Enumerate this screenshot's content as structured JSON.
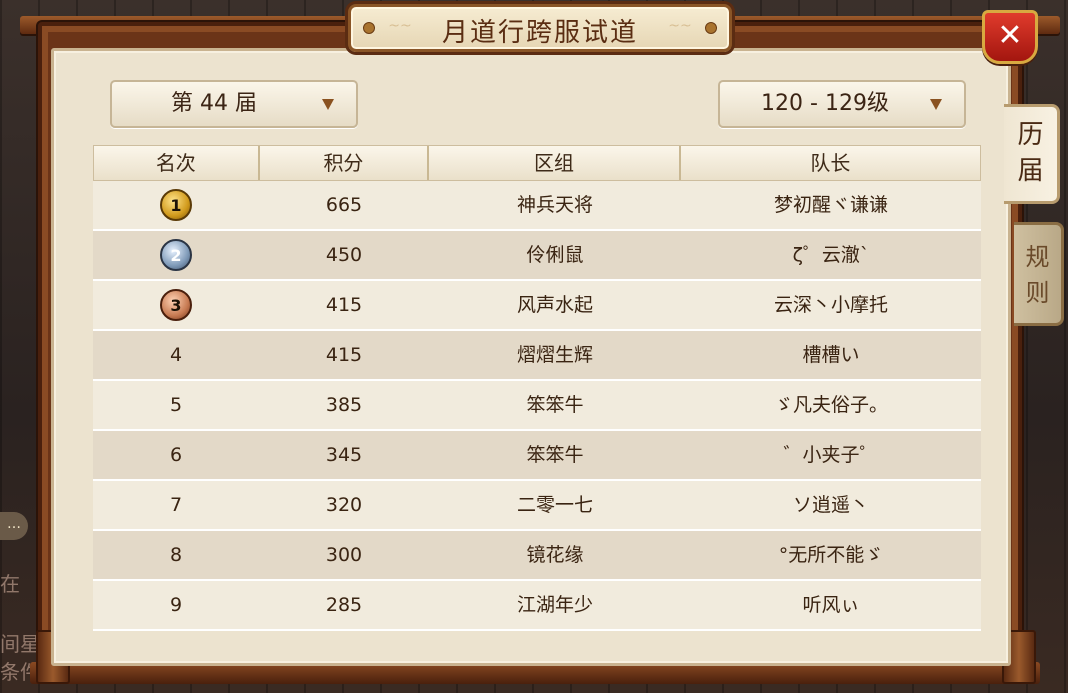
{
  "window": {
    "title": "月道行跨服试道",
    "close_label": "✕"
  },
  "filters": {
    "session_label": "第 44 届",
    "level_label": "120 - 129级"
  },
  "side_tabs": [
    {
      "label": "历届",
      "active": true
    },
    {
      "label": "规则",
      "active": false
    }
  ],
  "table": {
    "headers": [
      "名次",
      "积分",
      "区组",
      "队长"
    ],
    "rows": [
      {
        "rank": "1",
        "medal": "gold",
        "score": "665",
        "group": "神兵天将",
        "captain": "梦初醒ヾ谦谦"
      },
      {
        "rank": "2",
        "medal": "silver",
        "score": "450",
        "group": "伶俐鼠",
        "captain": "ζ゜云澈`"
      },
      {
        "rank": "3",
        "medal": "bronze",
        "score": "415",
        "group": "风声水起",
        "captain": "云深丶小摩托"
      },
      {
        "rank": "4",
        "medal": "",
        "score": "415",
        "group": "熠熠生辉",
        "captain": "槽槽い"
      },
      {
        "rank": "5",
        "medal": "",
        "score": "385",
        "group": "笨笨牛",
        "captain": "ゞ凡夫俗子。"
      },
      {
        "rank": "6",
        "medal": "",
        "score": "345",
        "group": "笨笨牛",
        "captain": "゛小夹子゜"
      },
      {
        "rank": "7",
        "medal": "",
        "score": "320",
        "group": "二零一七",
        "captain": "ソ逍遥丶"
      },
      {
        "rank": "8",
        "medal": "",
        "score": "300",
        "group": "镜花缘",
        "captain": "°无所不能ゞ"
      },
      {
        "rank": "9",
        "medal": "",
        "score": "285",
        "group": "江湖年少",
        "captain": "听风ぃ"
      }
    ]
  },
  "background_chat": {
    "line1": "在",
    "line2": "间星",
    "line3": "条件"
  },
  "colors": {
    "frame": "#6b3418",
    "panel": "#ece3cf",
    "row_light": "#f1ebdd",
    "row_dark": "#e3d9c8",
    "close_button": "#c62a1c",
    "text": "#3a2412"
  }
}
